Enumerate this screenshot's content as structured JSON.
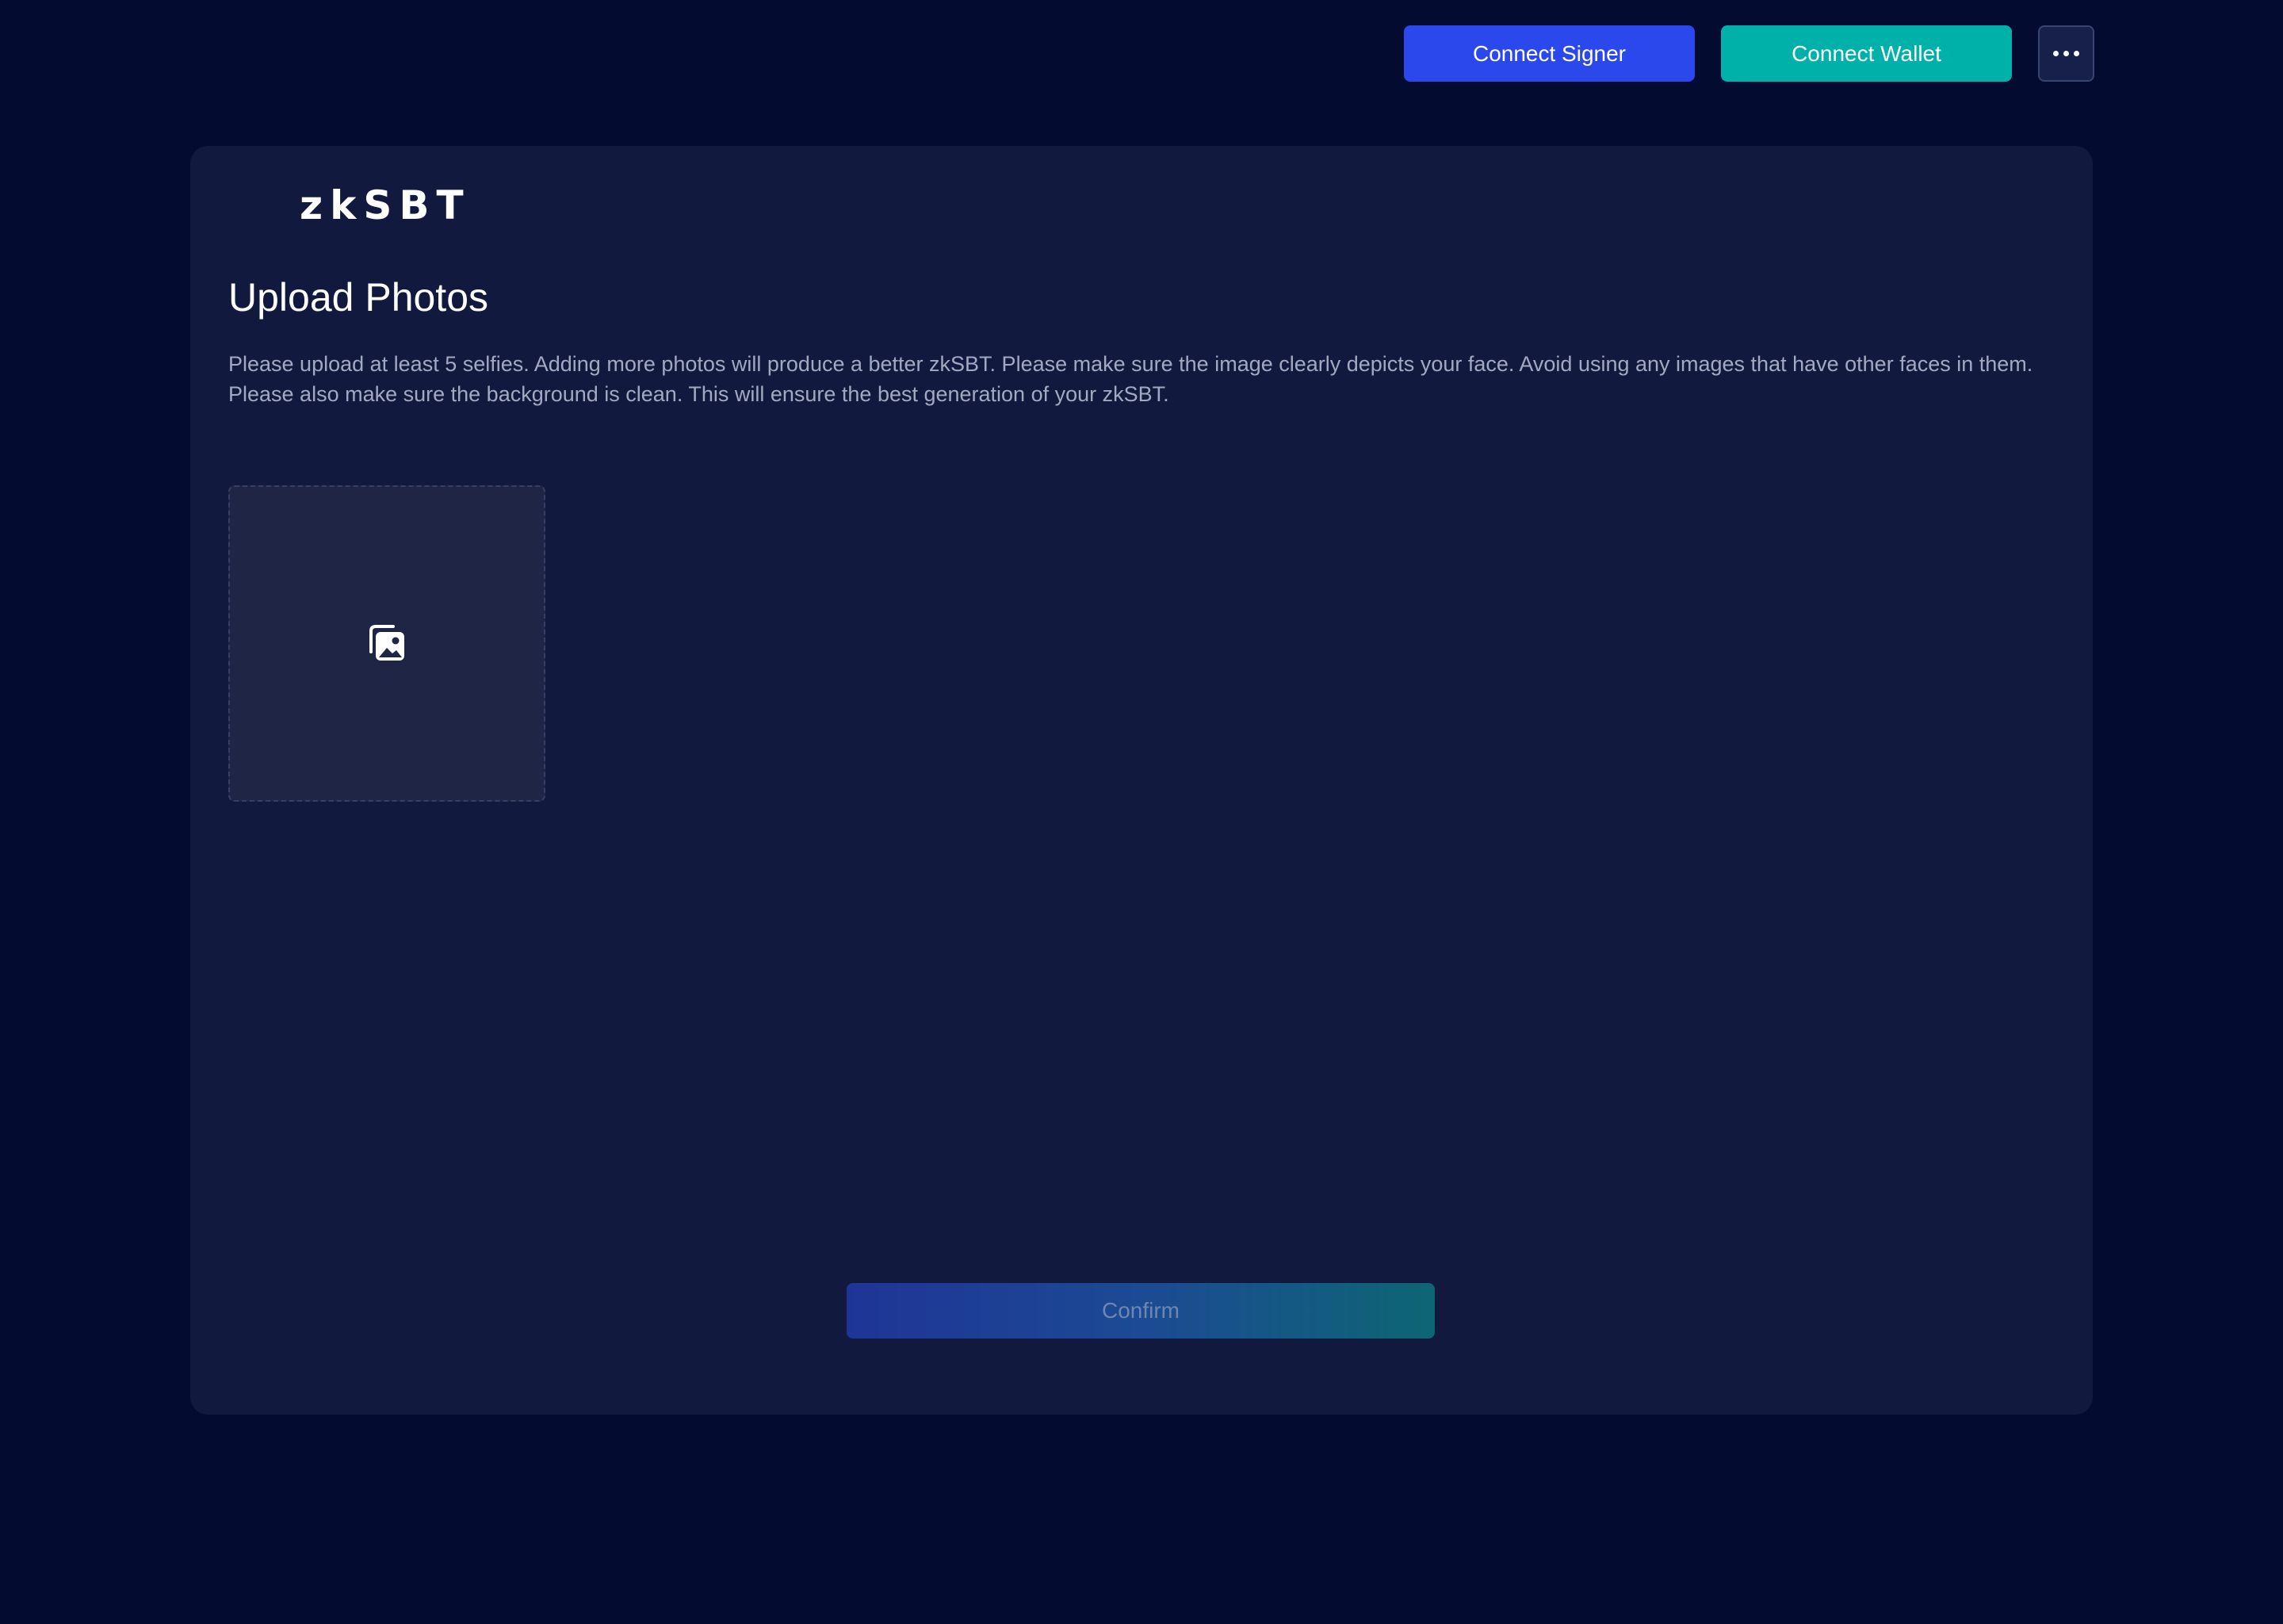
{
  "header": {
    "connect_signer_label": "Connect Signer",
    "connect_wallet_label": "Connect Wallet",
    "more_icon": "more-horizontal-icon"
  },
  "card": {
    "logo_text": "zkSBT",
    "title": "Upload Photos",
    "description": "Please upload at least 5 selfies. Adding more photos will produce a better zkSBT. Please make sure the image clearly depicts your face. Avoid using any images that have other faces in them. Please also make sure the background is clean. This will ensure the best generation of your zkSBT.",
    "upload_icon": "image-gallery-icon",
    "confirm_label": "Confirm"
  },
  "colors": {
    "background": "#030b30",
    "card": "#111a3e",
    "signer_button": "#2b48ec",
    "wallet_button": "#00b1a9",
    "dropzone": "#1f2544"
  }
}
